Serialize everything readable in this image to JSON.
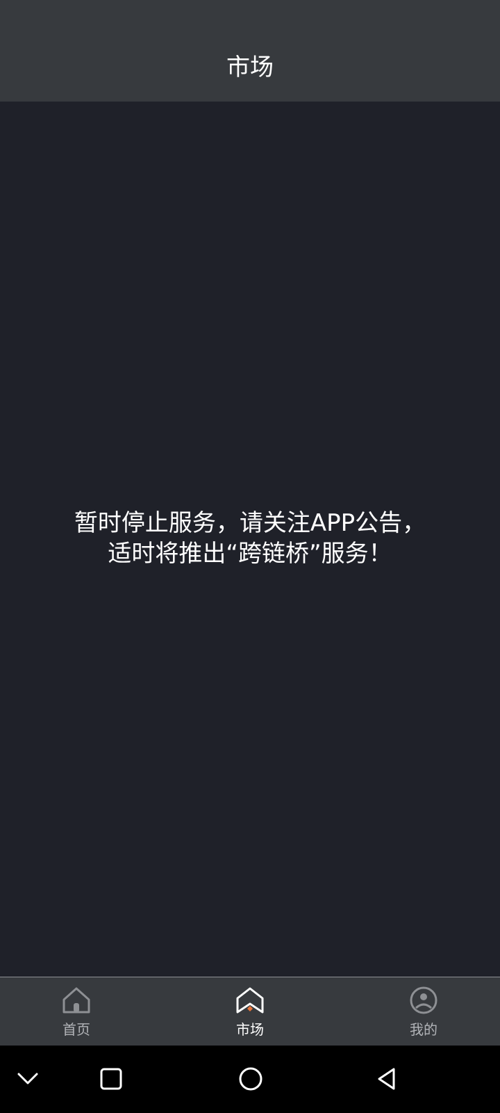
{
  "header": {
    "title": "市场"
  },
  "notice": {
    "line1": "暂时停止服务，请关注APP公告，",
    "line2": "适时将推出“跨链桥”服务！"
  },
  "tabs": [
    {
      "label": "首页",
      "icon": "home-icon",
      "active": false
    },
    {
      "label": "市场",
      "icon": "market-icon",
      "active": true
    },
    {
      "label": "我的",
      "icon": "profile-icon",
      "active": false
    }
  ],
  "system_nav": {
    "buttons": [
      "collapse-icon",
      "recent-apps-icon",
      "home-circle-icon",
      "back-icon"
    ]
  },
  "colors": {
    "background": "#1f2129",
    "header": "#373a3e",
    "tabbar": "#373a3e",
    "accent": "#e8743b",
    "text_primary": "#ffffff",
    "text_muted": "#b2b4b8"
  }
}
